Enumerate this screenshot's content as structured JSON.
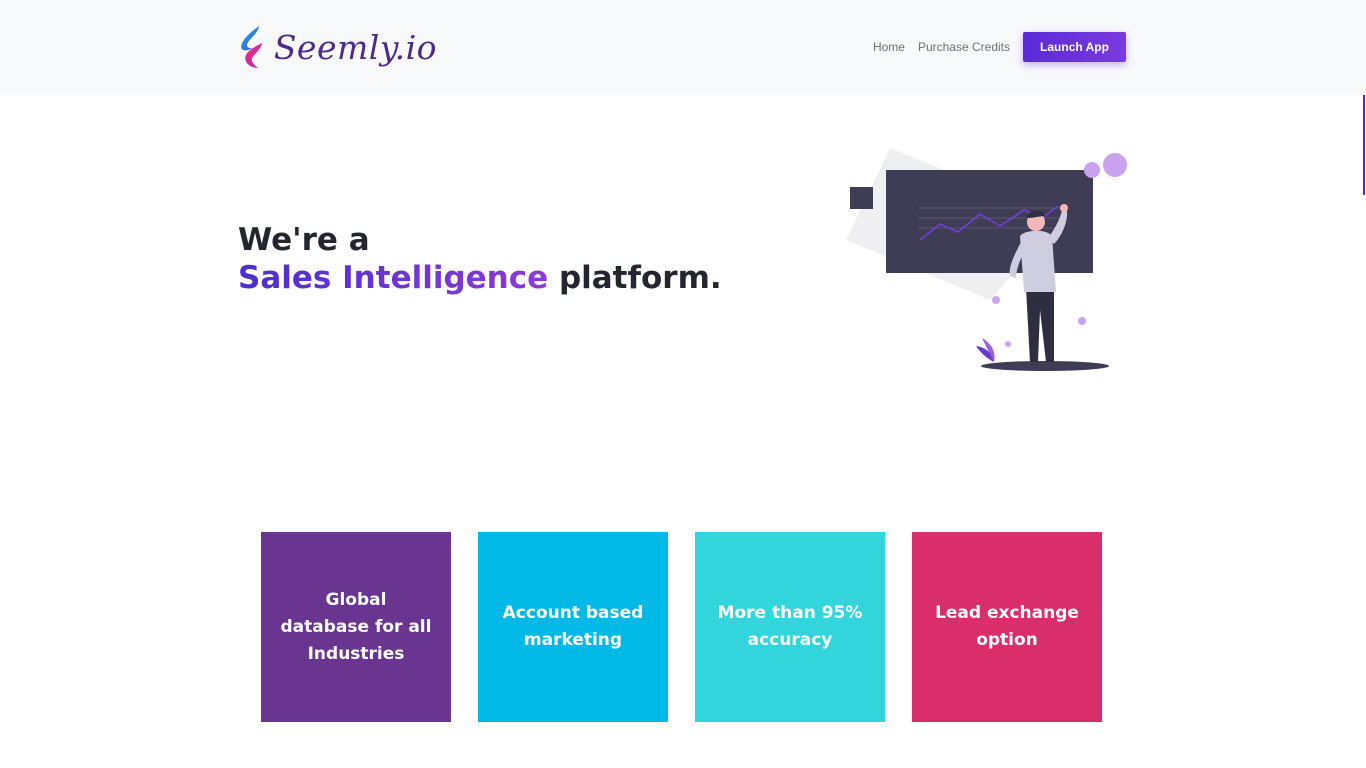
{
  "header": {
    "logo_text": "Seemly.io",
    "nav": {
      "home": "Home",
      "purchase_credits": "Purchase Credits",
      "launch_app": "Launch App"
    }
  },
  "hero": {
    "line1": "We're a",
    "accent": "Sales Intelligence",
    "line2_rest": " platform."
  },
  "features": [
    {
      "label": "Global database for all Industries",
      "color": "#6a3590"
    },
    {
      "label": "Account based marketing",
      "color": "#00b9e6"
    },
    {
      "label": "More than 95% accuracy",
      "color": "#32d5dc"
    },
    {
      "label": "Lead exchange option",
      "color": "#d92e6a"
    }
  ],
  "colors": {
    "brand_purple": "#5b2ad9",
    "header_bg": "#f8f9fb"
  },
  "icons": {
    "logo": "seemly-logo-icon",
    "illustration": "analytics-person-illustration"
  }
}
